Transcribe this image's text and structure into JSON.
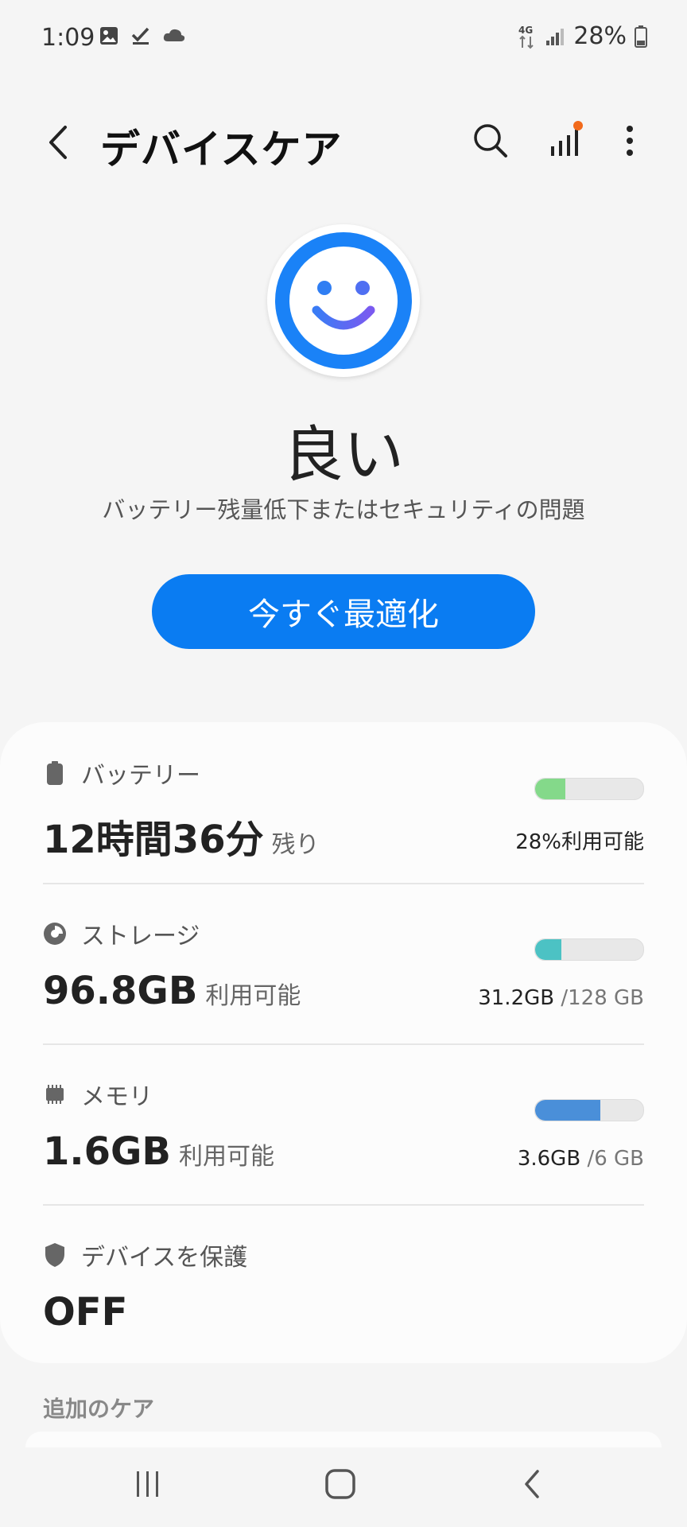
{
  "status_bar": {
    "time": "1:09",
    "network": "4G",
    "battery_pct": "28%"
  },
  "app_bar": {
    "title": "デバイスケア"
  },
  "status": {
    "word": "良い",
    "subtitle": "バッテリー残量低下またはセキュリティの問題"
  },
  "optimize_button": {
    "label": "今すぐ最適化"
  },
  "battery": {
    "label": "バッテリー",
    "value": "12時間36分",
    "value_suffix": "残り",
    "bar_text": "28%利用可能",
    "level": 0.28,
    "color": "#84d98a"
  },
  "storage": {
    "label": "ストレージ",
    "value": "96.8GB",
    "value_suffix": "利用可能",
    "used": "31.2GB",
    "total": "/128 GB",
    "level": 0.24,
    "color": "#4cc2c4"
  },
  "memory": {
    "label": "メモリ",
    "value": "1.6GB",
    "value_suffix": "利用可能",
    "used": "3.6GB",
    "total": "/6 GB",
    "level": 0.6,
    "color": "#4a8fd9"
  },
  "protection": {
    "label": "デバイスを保護",
    "value": "OFF"
  },
  "extra_care": {
    "title": "追加のケア"
  },
  "colors": {
    "accent": "#0a7cf2",
    "face_ring": "#1a82f7",
    "face_gradient_end": "#7a5af0"
  }
}
